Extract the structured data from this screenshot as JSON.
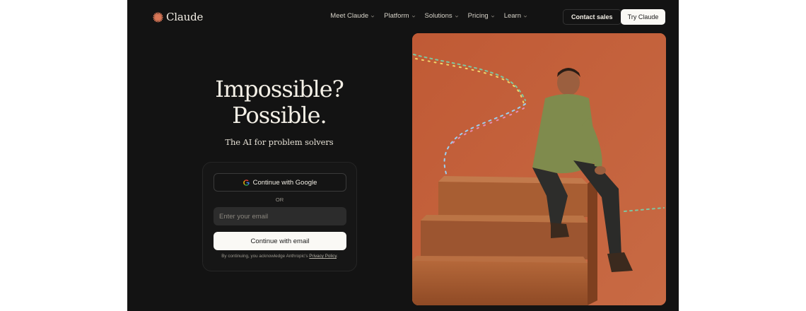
{
  "brand": {
    "name": "Claude",
    "accent": "#d97757"
  },
  "nav": {
    "items": [
      {
        "label": "Meet Claude"
      },
      {
        "label": "Platform"
      },
      {
        "label": "Solutions"
      },
      {
        "label": "Pricing"
      },
      {
        "label": "Learn"
      }
    ],
    "contact_label": "Contact sales",
    "try_label": "Try Claude"
  },
  "hero": {
    "headline_line1": "Impossible?",
    "headline_line2": "Possible.",
    "subheading": "The AI for problem solvers"
  },
  "auth": {
    "google_label": "Continue with Google",
    "or_label": "OR",
    "email_placeholder": "Enter your email",
    "email_value": "",
    "email_button_label": "Continue with email",
    "legal_prefix": "By continuing, you acknowledge Anthropic's",
    "privacy_link": "Privacy Policy",
    "legal_suffix": "."
  },
  "colors": {
    "background": "#131313",
    "text_primary": "#f3efe6",
    "button_light": "#faf9f5",
    "image_backdrop": "#c2613e"
  }
}
